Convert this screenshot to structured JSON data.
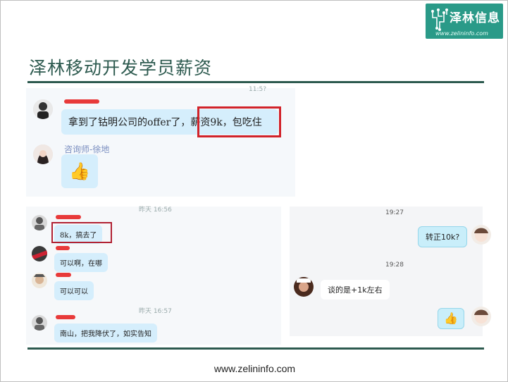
{
  "logo": {
    "brand": "泽林信息",
    "url": "www.zelininfo.com"
  },
  "title": "泽林移动开发学员薪资",
  "footer": "www.zelininfo.com",
  "chat1": {
    "message_a": "拿到了钴明公司的offer了，",
    "message_b": "薪资9k，包吃住",
    "advisor_name": "咨询师-徐地",
    "thumbs": "👍"
  },
  "chat2": {
    "time1": "昨天 16:56",
    "msg1": "8k，搞去了",
    "msg2": "可以啊，在哪",
    "msg3": "可以可以",
    "time2": "昨天 16:57",
    "msg4": "南山，把我降伏了，如实告知"
  },
  "chat3": {
    "time1": "19:27",
    "msg1": "转正10k?",
    "time2": "19:28",
    "msg2": "谈的是+1k左右",
    "thumbs": "👍"
  }
}
